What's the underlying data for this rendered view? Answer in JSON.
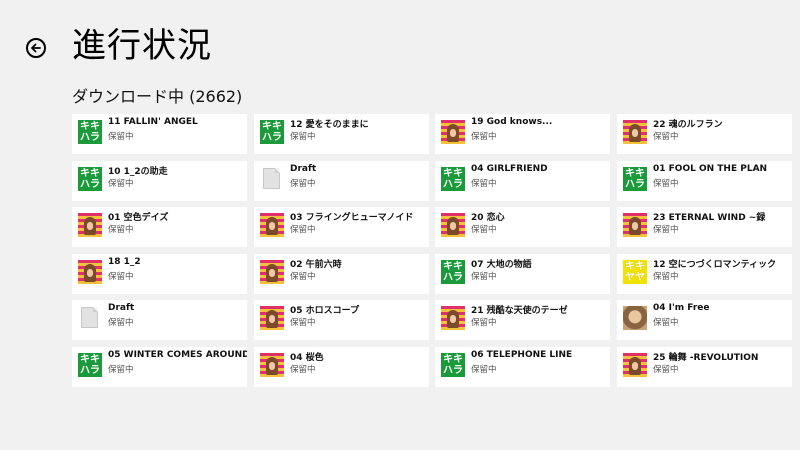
{
  "header": {
    "title": "進行状況"
  },
  "section": {
    "title": "ダウンロード中 (2662)"
  },
  "items": [
    {
      "title": "11 FALLIN' ANGEL",
      "status": "保留中",
      "thumb": "green"
    },
    {
      "title": "10 1_2の助走",
      "status": "保留中",
      "thumb": "green"
    },
    {
      "title": "01 空色デイズ",
      "status": "保留中",
      "thumb": "stripes"
    },
    {
      "title": "18 1_2",
      "status": "保留中",
      "thumb": "stripes"
    },
    {
      "title": "Draft",
      "status": "保留中",
      "thumb": "doc"
    },
    {
      "title": "05 WINTER COMES AROUND",
      "status": "保留中",
      "thumb": "green"
    },
    {
      "title": "12 愛をそのままに",
      "status": "保留中",
      "thumb": "green"
    },
    {
      "title": "Draft",
      "status": "保留中",
      "thumb": "doc"
    },
    {
      "title": "03 フライングヒューマノイド",
      "status": "保留中",
      "thumb": "stripes"
    },
    {
      "title": "02 午前六時",
      "status": "保留中",
      "thumb": "stripes"
    },
    {
      "title": "05 ホロスコープ",
      "status": "保留中",
      "thumb": "stripes"
    },
    {
      "title": "04 桜色",
      "status": "保留中",
      "thumb": "stripes"
    },
    {
      "title": "19 God knows...",
      "status": "保留中",
      "thumb": "stripes"
    },
    {
      "title": "04 GIRLFRIEND",
      "status": "保留中",
      "thumb": "green"
    },
    {
      "title": "20 恋心",
      "status": "保留中",
      "thumb": "stripes"
    },
    {
      "title": "07 大地の物語",
      "status": "保留中",
      "thumb": "green"
    },
    {
      "title": "21 残酷な天使のテーゼ",
      "status": "保留中",
      "thumb": "stripes"
    },
    {
      "title": "06 TELEPHONE LINE",
      "status": "保留中",
      "thumb": "green"
    },
    {
      "title": "22 魂のルフラン",
      "status": "保留中",
      "thumb": "stripes"
    },
    {
      "title": "01 FOOL ON THE PLAN",
      "status": "保留中",
      "thumb": "green"
    },
    {
      "title": "23 ETERNAL WIND ~録",
      "status": "保留中",
      "thumb": "stripes"
    },
    {
      "title": "12 空につづくロマンティック",
      "status": "保留中",
      "thumb": "yellow"
    },
    {
      "title": "04 I'm Free",
      "status": "保留中",
      "thumb": "photo"
    },
    {
      "title": "25 輪舞 -REVOLUTION",
      "status": "保留中",
      "thumb": "stripes"
    }
  ],
  "icons": {
    "back": "back-arrow-icon",
    "green_thumb_text": [
      "キキ",
      "ハラ"
    ],
    "yellow_thumb_text": [
      "キキ",
      "ヤヤ"
    ]
  },
  "colors": {
    "background": "#f1f1f1",
    "tile": "#ffffff",
    "green_thumb": "#1a9a3a",
    "yellow_thumb": "#f2e200"
  }
}
